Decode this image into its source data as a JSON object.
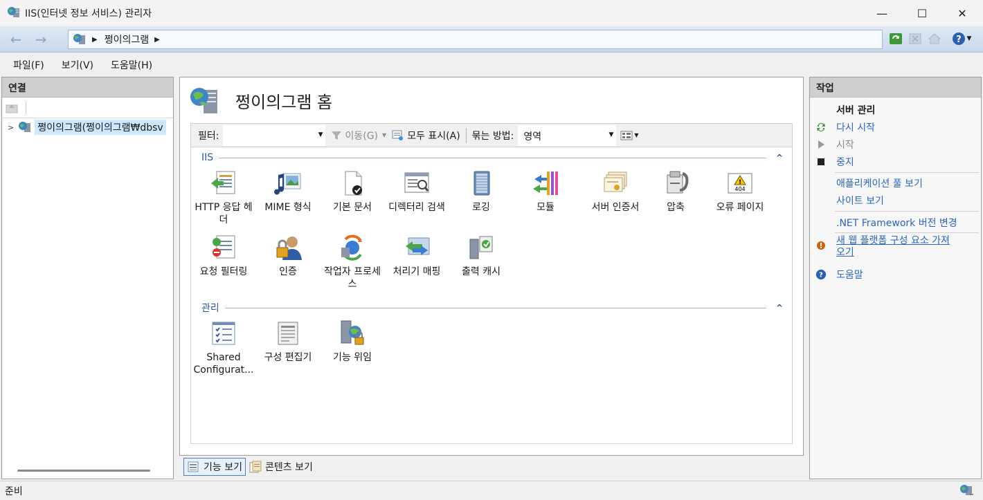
{
  "window": {
    "title": "IIS(인터넷 정보 서비스) 관리자",
    "minimize": "—",
    "maximize": "☐",
    "close": "✕"
  },
  "nav": {
    "breadcrumb": "쩡이의그램"
  },
  "menu": {
    "file": "파일(F)",
    "view": "보기(V)",
    "help": "도움말(H)"
  },
  "connections": {
    "header": "연결",
    "tree_item": "쩡이의그램(쩡이의그램₩dbsv"
  },
  "main": {
    "title": "쩡이의그램 홈",
    "filter_label": "필터:",
    "go_label": "이동(G)",
    "show_all_label": "모두 표시(A)",
    "group_by_label": "묶는 방법:",
    "group_by_value": "영역",
    "sections": [
      {
        "name": "IIS",
        "features": [
          "HTTP 응답 헤더",
          "MIME 형식",
          "기본 문서",
          "디렉터리 검색",
          "로깅",
          "모듈",
          "서버 인증서",
          "압축",
          "오류 페이지",
          "요청 필터링",
          "인증",
          "작업자 프로세스",
          "처리기 매핑",
          "출력 캐시"
        ]
      },
      {
        "name": "관리",
        "features": [
          "Shared Configurat...",
          "구성 편집기",
          "기능 위임"
        ]
      }
    ]
  },
  "actions": {
    "header": "작업",
    "server_manage": "서버 관리",
    "restart": "다시 시작",
    "start": "시작",
    "stop": "중지",
    "view_app_pools": "애플리케이션 풀 보기",
    "view_sites": "사이트 보기",
    "change_net": ".NET Framework 버전 변경",
    "get_web_platform_1": "새 웹 플랫폼 구성 요소 가져",
    "get_web_platform_2": "오기",
    "help": "도움말"
  },
  "view_tabs": {
    "features_view": "기능 보기",
    "content_view": "콘텐츠 보기"
  },
  "status": {
    "text": "준비"
  },
  "colors": {
    "link": "#2a64c4",
    "section": "#2457a4",
    "selection": "#cce8ff"
  }
}
